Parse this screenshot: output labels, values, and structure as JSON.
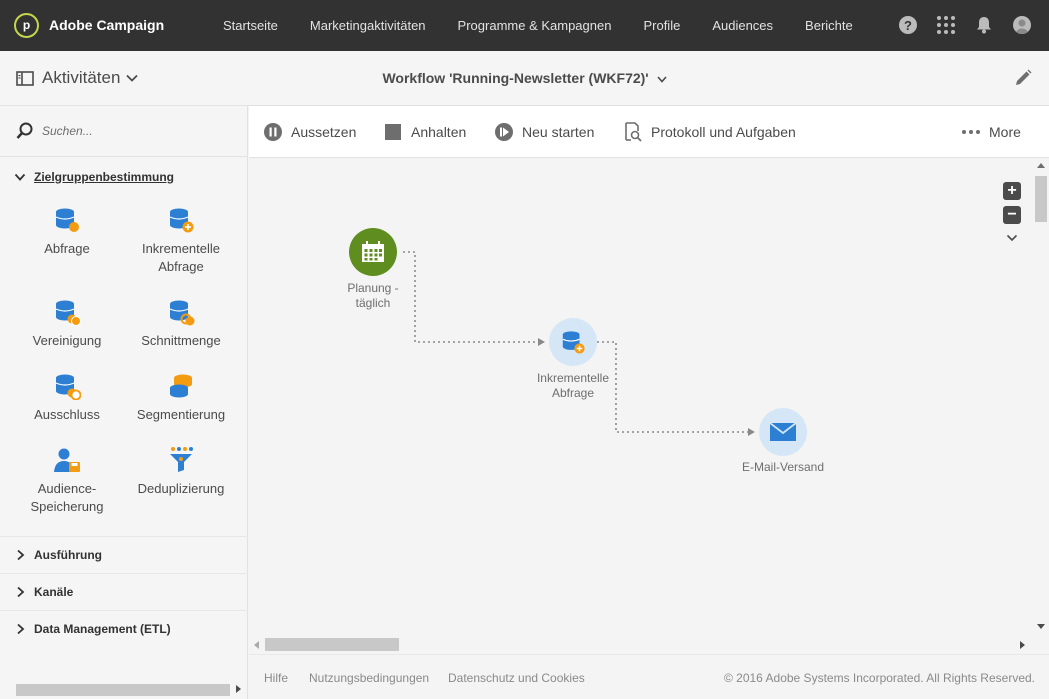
{
  "app": {
    "name": "Adobe Campaign",
    "logo_letter": "p"
  },
  "nav": {
    "links": [
      "Startseite",
      "Marketingaktivitäten",
      "Programme & Kampagnen",
      "Profile",
      "Audiences",
      "Berichte"
    ],
    "icons": [
      "help-icon",
      "apps-grid-icon",
      "bell-icon",
      "user-avatar-icon"
    ]
  },
  "subheader": {
    "activities_label": "Aktivitäten",
    "workflow_title": "Workflow 'Running-Newsletter (WKF72)'"
  },
  "search": {
    "placeholder": "Suchen..."
  },
  "palette": {
    "open_section": "Zielgruppenbestimmung",
    "activities": [
      {
        "label": "Abfrage",
        "icon": "query-icon"
      },
      {
        "label": "Inkrementelle Abfrage",
        "icon": "incremental-query-icon"
      },
      {
        "label": "Vereinigung",
        "icon": "union-icon"
      },
      {
        "label": "Schnittmenge",
        "icon": "intersection-icon"
      },
      {
        "label": "Ausschluss",
        "icon": "exclusion-icon"
      },
      {
        "label": "Segmentierung",
        "icon": "segmentation-icon"
      },
      {
        "label": "Audience-Speicherung",
        "icon": "save-audience-icon"
      },
      {
        "label": "Deduplizierung",
        "icon": "deduplication-icon"
      }
    ],
    "collapsed_sections": [
      "Ausführung",
      "Kanäle",
      "Data Management (ETL)"
    ]
  },
  "toolbar": {
    "pause": "Aussetzen",
    "stop": "Anhalten",
    "restart": "Neu starten",
    "logs": "Protokoll und Aufgaben",
    "more": "More"
  },
  "workflow": {
    "nodes": [
      {
        "label": "Planung - täglich",
        "icon": "calendar-icon",
        "color": "#5f8d1f"
      },
      {
        "label": "Inkrementelle Abfrage",
        "icon": "incremental-query-icon",
        "color": "#d5e7f7"
      },
      {
        "label": "E-Mail-Versand",
        "icon": "envelope-icon",
        "color": "#d5e7f7"
      }
    ]
  },
  "footer": {
    "links": [
      "Hilfe",
      "Nutzungsbedingungen",
      "Datenschutz und Cookies"
    ],
    "copyright": "© 2016 Adobe Systems Incorporated. All Rights Reserved."
  },
  "colors": {
    "topbar": "#323232",
    "accent_blue": "#2d7fd3",
    "accent_orange": "#f39c12",
    "node_green": "#5f8d1f"
  }
}
